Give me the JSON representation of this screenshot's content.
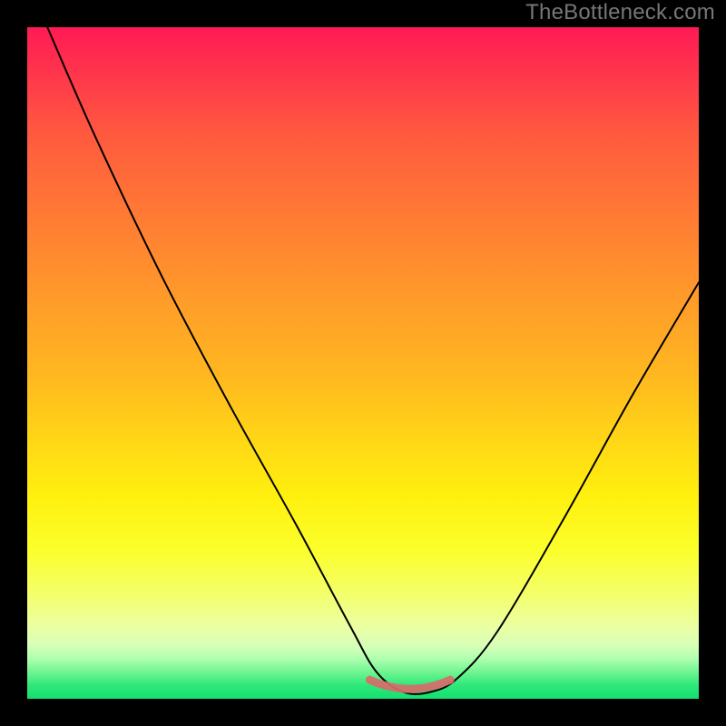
{
  "watermark": "TheBottleneck.com",
  "marker_color": "#d96a6a",
  "curve_color": "#000000",
  "gradient_stops": [
    {
      "pct": 0,
      "color": "#ff1a55"
    },
    {
      "pct": 40,
      "color": "#ff9a2a"
    },
    {
      "pct": 70,
      "color": "#fff00e"
    },
    {
      "pct": 92,
      "color": "#d8ffb8"
    },
    {
      "pct": 100,
      "color": "#14e070"
    }
  ],
  "chart_data": {
    "type": "line",
    "title": "",
    "xlabel": "",
    "ylabel": "",
    "xlim": [
      0,
      100
    ],
    "ylim": [
      0,
      100
    ],
    "series": [
      {
        "name": "bottleneck-curve",
        "x": [
          3,
          10,
          20,
          30,
          40,
          48,
          52,
          56,
          60,
          64,
          70,
          80,
          90,
          100
        ],
        "values": [
          100,
          84,
          63,
          44,
          26,
          11,
          4,
          1,
          1,
          3,
          10,
          27,
          45,
          62
        ]
      }
    ],
    "annotations": [
      {
        "name": "optimal-band",
        "x_range": [
          51,
          63
        ],
        "y": 2
      }
    ]
  }
}
